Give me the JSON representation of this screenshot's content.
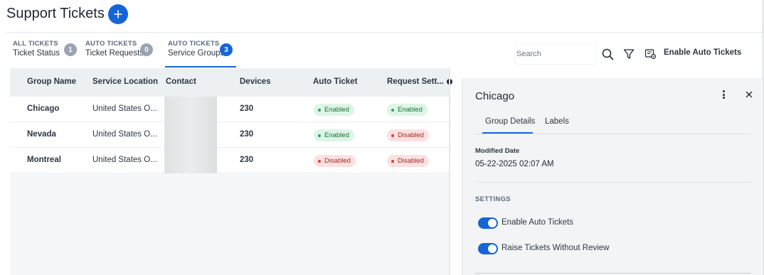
{
  "header": {
    "title": "Support Tickets",
    "add_icon": "plus-icon"
  },
  "tabs": [
    {
      "category": "ALL TICKETS",
      "label": "Ticket Status",
      "count": "1",
      "active": false
    },
    {
      "category": "AUTO TICKETS",
      "label": "Ticket Requests",
      "count": "0",
      "active": false
    },
    {
      "category": "AUTO TICKETS",
      "label": "Service Groups",
      "count": "3",
      "active": true
    }
  ],
  "toolbar": {
    "search_placeholder": "Search",
    "search_icon": "search-icon",
    "filter_icon": "filter-icon",
    "auto_ticket_icon": "gear-ticket-icon",
    "enable_auto_tickets_label": "Enable Auto Tickets"
  },
  "table": {
    "columns": [
      "Group Name",
      "Service Location",
      "Contact",
      "Devices",
      "Auto Ticket",
      "Request Sett..."
    ],
    "rows": [
      {
        "group": "Chicago",
        "location": "United States O...",
        "contact": "",
        "devices": "230",
        "auto_ticket": "Enabled",
        "request_settings": "Enabled"
      },
      {
        "group": "Nevada",
        "location": "United States O...",
        "contact": "",
        "devices": "230",
        "auto_ticket": "Enabled",
        "request_settings": "Disabled"
      },
      {
        "group": "Montreal",
        "location": "United States O...",
        "contact": "",
        "devices": "230",
        "auto_ticket": "Disabled",
        "request_settings": "Disabled"
      }
    ]
  },
  "panel": {
    "title": "Chicago",
    "tabs": [
      "Group Details",
      "Labels"
    ],
    "modified_label": "Modified Date",
    "modified_value": "05-22-2025 02:07 AM",
    "settings_label": "SETTINGS",
    "toggles": [
      {
        "label": "Enable Auto Tickets",
        "on": true
      },
      {
        "label": "Raise Tickets Without Review",
        "on": true
      }
    ]
  },
  "colors": {
    "accent": "#1565d8",
    "enabled_bg": "#dcf5e5",
    "disabled_bg": "#fde0e0"
  }
}
